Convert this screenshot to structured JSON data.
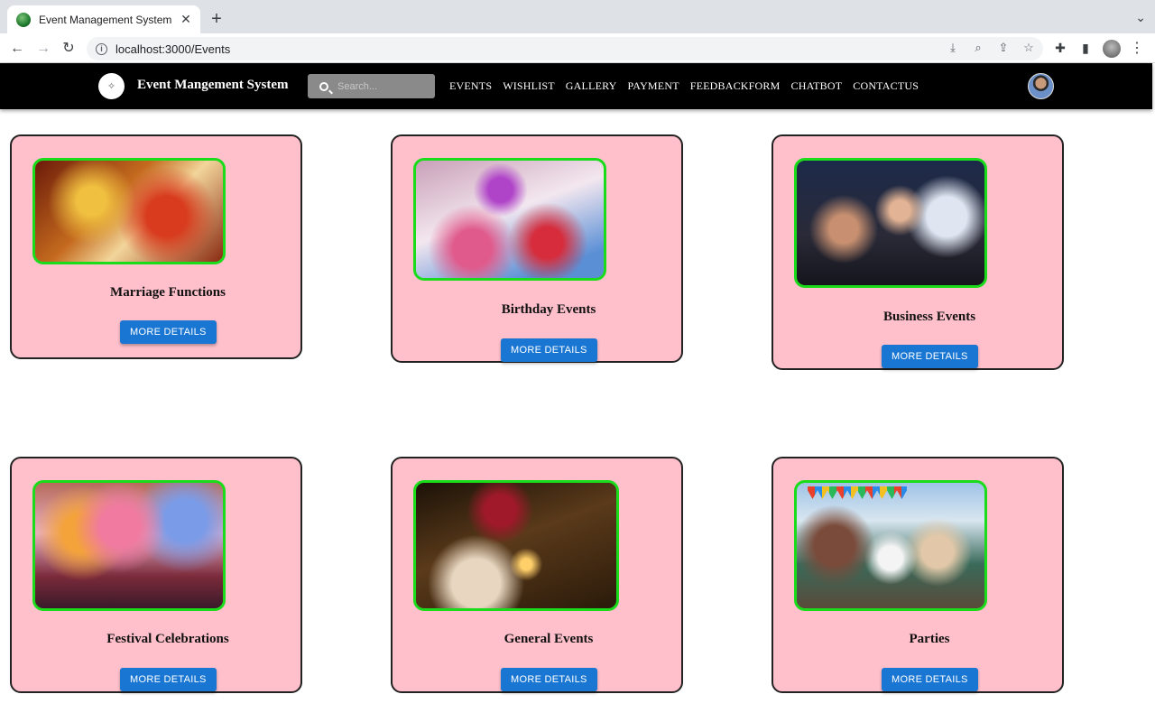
{
  "browser": {
    "tab_title": "Event Management System",
    "url": "localhost:3000/Events",
    "icons": [
      "back-icon",
      "forward-icon",
      "reload-icon",
      "info-icon",
      "install-icon",
      "zoom-icon",
      "share-icon",
      "star-icon",
      "extensions-icon",
      "sidepanel-icon",
      "profile-icon",
      "menu-icon"
    ]
  },
  "navbar": {
    "brand": "Event Mangement System",
    "search_placeholder": "Search...",
    "links": [
      "EVENTS",
      "WISHLIST",
      "GALLERY",
      "PAYMENT",
      "FEEDBACKFORM",
      "CHATBOT",
      "CONTACTUS"
    ]
  },
  "cards": [
    {
      "title": "Marriage Functions",
      "button": "MORE DETAILS"
    },
    {
      "title": "Birthday Events",
      "button": "MORE DETAILS"
    },
    {
      "title": "Business Events",
      "button": "MORE DETAILS"
    },
    {
      "title": "Festival Celebrations",
      "button": "MORE DETAILS"
    },
    {
      "title": "General Events",
      "button": "MORE DETAILS"
    },
    {
      "title": "Parties",
      "button": "MORE DETAILS"
    }
  ],
  "colors": {
    "card_bg": "#ffc0cb",
    "photo_border": "#1bdc1b",
    "button": "#1976d2",
    "navbar": "#000000"
  }
}
